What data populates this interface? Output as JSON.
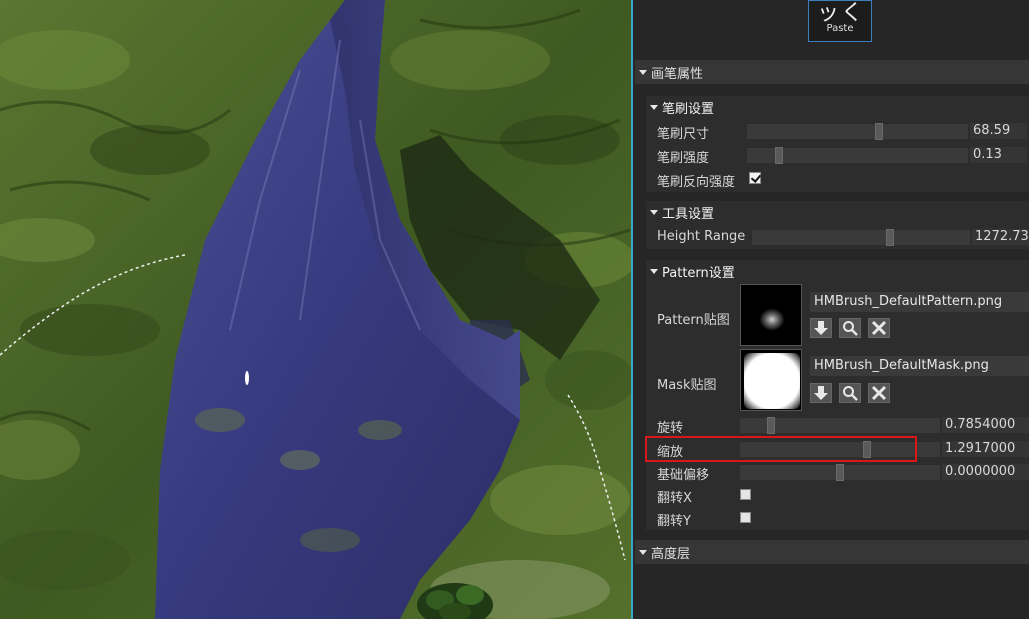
{
  "toolbar": {
    "paste_label": "Paste",
    "paste_icon": "paste-icon"
  },
  "sections": {
    "brush_properties": "画笔属性",
    "height_layer": "高度层"
  },
  "brush_settings": {
    "title": "笔刷设置",
    "size_label": "笔刷尺寸",
    "size_value": "68.59",
    "size_level": 0.6,
    "strength_label": "笔刷强度",
    "strength_value": "0.13",
    "strength_level": 0.13,
    "reverse_label": "笔刷反向强度",
    "reverse_checked": true
  },
  "tool_settings": {
    "title": "工具设置",
    "height_range_label": "Height Range",
    "height_range_value": "1272.73",
    "height_range_level": 0.64
  },
  "pattern_settings": {
    "title": "Pattern设置",
    "pattern_texture_label": "Pattern贴图",
    "pattern_texture_name": "HMBrush_DefaultPattern.png",
    "mask_texture_label": "Mask贴图",
    "mask_texture_name": "HMBrush_DefaultMask.png",
    "rotation_label": "旋转",
    "rotation_value": "0.7854000",
    "rotation_level": 0.14,
    "scale_label": "缩放",
    "scale_value": "1.2917000",
    "scale_level": 0.64,
    "offset_label": "基础偏移",
    "offset_value": "0.0000000",
    "offset_level": 0.5,
    "flip_x_label": "翻转X",
    "flip_x_checked": false,
    "flip_y_label": "翻转Y",
    "flip_y_checked": false
  },
  "colors": {
    "accent": "#3aa6c9",
    "highlight": "#d81818"
  }
}
